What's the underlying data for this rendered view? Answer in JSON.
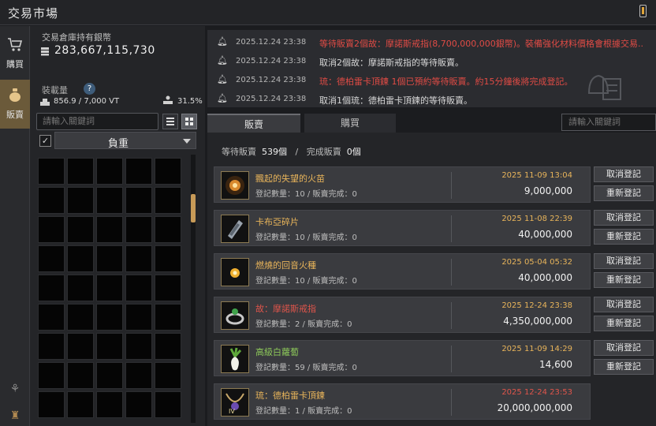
{
  "window": {
    "title": "交易市場"
  },
  "rail": {
    "buy_label": "購買",
    "sell_label": "販賣"
  },
  "wallet": {
    "label": "交易倉庫持有銀幣",
    "amount": "283,667,115,730"
  },
  "weight": {
    "label": "裝載量",
    "help": "?",
    "value": "856.9 / 7,000 VT",
    "percent": "31.5%"
  },
  "left_search": {
    "placeholder": "請輸入關鍵詞"
  },
  "filter": {
    "checked": true,
    "selected": "負重"
  },
  "notifications": [
    {
      "time": "2025.12.24 23:38",
      "text": "等待販賣2個故：摩諾斯戒指(8,700,000,000銀幣)。裝備強化材料價格會根據交易...",
      "color": "#e04b45"
    },
    {
      "time": "2025.12.24 23:38",
      "text": "取消2個故：摩諾斯戒指的等待販賣。",
      "color": "#d8d8d8"
    },
    {
      "time": "2025.12.24 23:38",
      "text": "琉：德柏雷卡頂鍊 1個已預約等待販賣。約15分鐘後將完成登記。",
      "color": "#e04b45"
    },
    {
      "time": "2025.12.24 23:38",
      "text": "取消1個琉：德柏雷卡頂鍊的等待販賣。",
      "color": "#d8d8d8"
    }
  ],
  "tabs": {
    "sell": "販賣",
    "buy": "購買"
  },
  "right_search": {
    "placeholder": "請輸入關鍵詞"
  },
  "summary": {
    "waiting_label": "等待販賣",
    "waiting_count": "539個",
    "sep": "/",
    "done_label": "完成販賣",
    "done_count": "0個"
  },
  "listings": [
    {
      "name": "飄起的失望的火苗",
      "name_color": "#e8b45a",
      "qty": "登記數量：10 / 販賣完成：0",
      "date": "2025 11-09 13:04",
      "date_color": "#e8b45a",
      "price": "9,000,000",
      "icon": "flame-orb-icon",
      "btn1": "取消登記",
      "btn2": "重新登記"
    },
    {
      "name": "卡布亞碎片",
      "name_color": "#e8b45a",
      "qty": "登記數量：10 / 販賣完成：0",
      "date": "2025 11-08 22:39",
      "date_color": "#e8b45a",
      "price": "40,000,000",
      "icon": "shard-icon",
      "btn1": "取消登記",
      "btn2": "重新登記"
    },
    {
      "name": "燃燒的回音火種",
      "name_color": "#e8b45a",
      "qty": "登記數量：10 / 販賣完成：0",
      "date": "2025 05-04 05:32",
      "date_color": "#e8b45a",
      "price": "40,000,000",
      "icon": "ember-icon",
      "btn1": "取消登記",
      "btn2": "重新登記"
    },
    {
      "name": "故：摩諾斯戒指",
      "name_color": "#e0554b",
      "qty": "登記數量：2 / 販賣完成：0",
      "date": "2025 12-24 23:38",
      "date_color": "#e8b45a",
      "price": "4,350,000,000",
      "icon": "ring-icon",
      "btn1": "取消登記",
      "btn2": "重新登記"
    },
    {
      "name": "高級白蘿蔔",
      "name_color": "#8dc85a",
      "qty": "登記數量：59 / 販賣完成：0",
      "date": "2025 11-09 14:29",
      "date_color": "#e8b45a",
      "price": "14,600",
      "icon": "radish-icon",
      "btn1": "取消登記",
      "btn2": "重新登記"
    },
    {
      "name": "琉：德柏雷卡頂鍊",
      "name_color": "#e8b45a",
      "qty": "登記數量：1 / 販賣完成：0",
      "date": "2025 12-24 23:53",
      "date_color": "#e0554b",
      "price": "20,000,000,000",
      "icon": "necklace-icon",
      "btn1": "",
      "btn2": ""
    }
  ]
}
